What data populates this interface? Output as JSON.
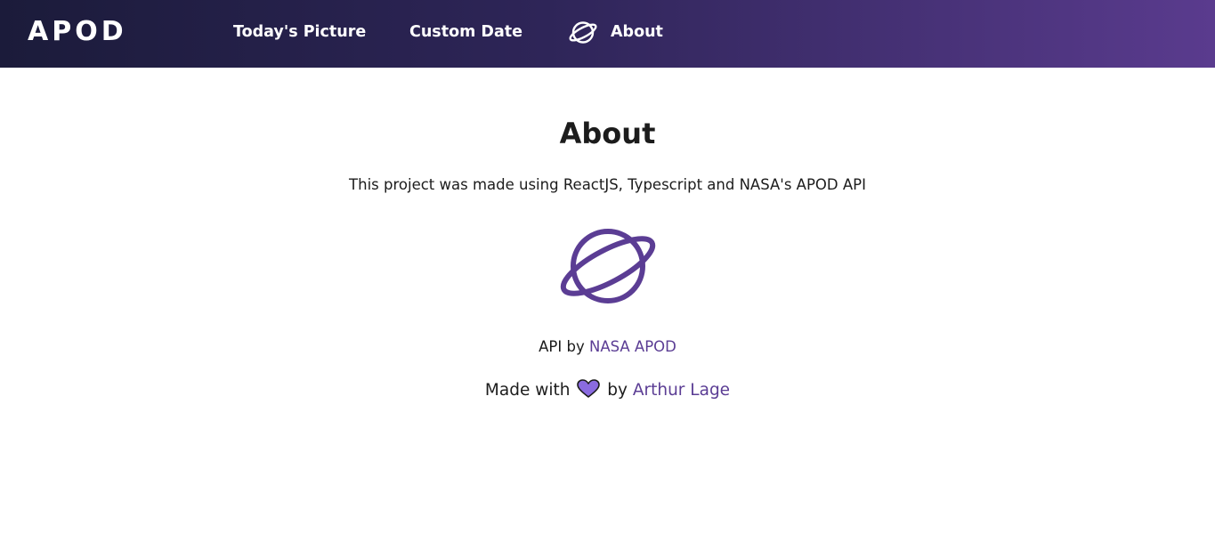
{
  "navbar": {
    "brand": "APOD",
    "links": [
      {
        "label": "Today's Picture"
      },
      {
        "label": "Custom Date"
      },
      {
        "label": "About",
        "icon": "planet-icon"
      }
    ]
  },
  "about": {
    "title": "About",
    "description": "This project was made using ReactJS, Typescript and NASA's APOD API",
    "illustration_icon": "planet-icon",
    "api_prefix": "API by",
    "api_link": "NASA APOD",
    "made_prefix": "Made with",
    "made_icon": "heart-icon",
    "made_by": "by",
    "author_link": "Arthur Lage"
  },
  "colors": {
    "accent": "#5b3d94",
    "heart_fill": "#8a6be0",
    "navbar_start": "#1b1b3a",
    "navbar_end": "#5a3b8e",
    "text": "#1c1c1c"
  }
}
